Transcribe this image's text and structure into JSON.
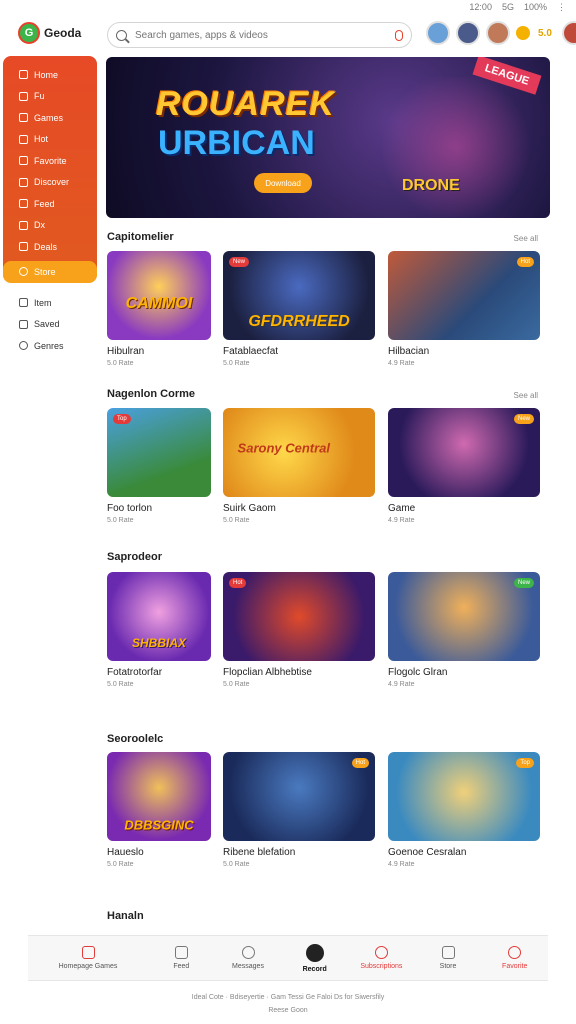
{
  "status": {
    "items": [
      "12:00",
      "5G",
      "100%",
      "⋮"
    ]
  },
  "header": {
    "logo_text": "Geoda",
    "search_placeholder": "Search games, apps & videos",
    "coins": "5.0"
  },
  "sidebar": {
    "items": [
      {
        "label": "Home"
      },
      {
        "label": "Fu"
      },
      {
        "label": "Games"
      },
      {
        "label": "Hot"
      },
      {
        "label": "Favorite"
      },
      {
        "label": "Discover"
      },
      {
        "label": "Feed"
      },
      {
        "label": "Dx"
      },
      {
        "label": "Deals"
      },
      {
        "label": "Store"
      }
    ],
    "lower": [
      {
        "label": "Item"
      },
      {
        "label": "Saved"
      },
      {
        "label": "Genres"
      }
    ]
  },
  "hero": {
    "title": "ROUAREK",
    "subtitle": "URBICAN",
    "button": "Download",
    "ribbon": "LEAGUE",
    "badge": "DRONE"
  },
  "sections": [
    {
      "title": "Capitomelier",
      "more": "See all",
      "cards": [
        {
          "art": "CAMMOI",
          "name": "Hibulran",
          "meta": "5.0 Rate"
        },
        {
          "art": "GFDRRHEED",
          "name": "Fatablaecfat",
          "meta": "5.0 Rate",
          "badge": "New"
        },
        {
          "art": "",
          "name": "Hilbacian",
          "meta": "4.9 Rate",
          "badge_r": "Hot"
        }
      ]
    },
    {
      "title": "Nagenlon Corme",
      "more": "See all",
      "cards": [
        {
          "art": "",
          "name": "Foo torlon",
          "meta": "5.0 Rate",
          "badge": "Top"
        },
        {
          "art": "Sarony Central",
          "name": "Suirk Gaom",
          "meta": "5.0 Rate"
        },
        {
          "art": "",
          "name": "Game",
          "meta": "4.9 Rate",
          "badge_r": "New"
        }
      ]
    },
    {
      "title": "Saprodeor",
      "cards": [
        {
          "art": "SHBBIAX",
          "name": "Fotatrotorfar",
          "meta": "5.0 Rate"
        },
        {
          "art": "",
          "name": "Flopclian Albhebtise",
          "meta": "5.0 Rate",
          "badge": "Hot"
        },
        {
          "art": "",
          "name": "Flogolc Glran",
          "meta": "4.9 Rate",
          "badge_r": "New"
        }
      ]
    },
    {
      "title": "Seoroolelc",
      "cards": [
        {
          "art": "DBBSGINC",
          "name": "Haueslo",
          "meta": "5.0 Rate"
        },
        {
          "art": "",
          "name": "Ribene blefation",
          "meta": "5.0 Rate",
          "badge_r": "Hot"
        },
        {
          "art": "",
          "name": "Goenoe Cesralan",
          "meta": "4.9 Rate",
          "badge_r": "Top"
        }
      ]
    }
  ],
  "next_section_title": "Hanaln",
  "bottomnav": [
    {
      "label": "Homepage Games"
    },
    {
      "label": "Feed"
    },
    {
      "label": "Messages"
    },
    {
      "label": "Record"
    },
    {
      "label": "Subscriptions"
    },
    {
      "label": "Store"
    },
    {
      "label": "Favorite"
    }
  ],
  "footer": {
    "line1": "Ideal Cote · Bdiseyertie · Gam Tessi Ge Faloi Ds for Siwersfily",
    "line2": "Reese Goon"
  },
  "colors": {
    "accent": "#e64a26",
    "active": "#f7a21a",
    "brand_green": "#3cb44a"
  }
}
